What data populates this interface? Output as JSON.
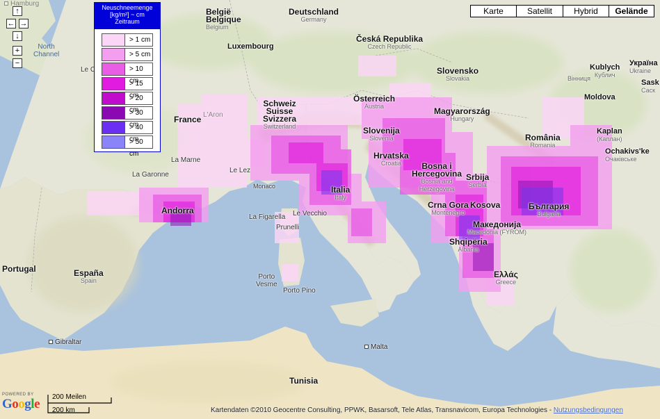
{
  "map_types": [
    {
      "label": "Karte",
      "active": false
    },
    {
      "label": "Satellit",
      "active": false
    },
    {
      "label": "Hybrid",
      "active": false
    },
    {
      "label": "Gelände",
      "active": true
    }
  ],
  "legend": {
    "title_line1": "Neuschneemenge",
    "title_line2": "[kg/m²] ~ cm",
    "title_line3": "Zeitraum",
    "rows": [
      {
        "label": "> 1 cm",
        "color": "#fbd6f6"
      },
      {
        "label": "> 5 cm",
        "color": "#f49ef0"
      },
      {
        "label": "> 10 cm",
        "color": "#ea5ee6"
      },
      {
        "label": "> 15 cm",
        "color": "#e21be0"
      },
      {
        "label": "> 20 cm",
        "color": "#c00ccc"
      },
      {
        "label": "> 30 cm",
        "color": "#8a09b2"
      },
      {
        "label": "> 40 cm",
        "color": "#6a2ff2"
      },
      {
        "label": "> 50 cm",
        "color": "#8b84f8"
      }
    ]
  },
  "nav": {
    "up": "↑",
    "left": "←",
    "right": "→",
    "down": "↓",
    "zoom_in": "+",
    "zoom_out": "−"
  },
  "labels": {
    "hamburg": "Hamburg",
    "north_channel_1": "North",
    "north_channel_2": "Channel",
    "le_c": "Le C",
    "belgie": "België",
    "belgique": "Belgique",
    "belgium": "Belgium",
    "luxembourg": "Luxembourg",
    "deutschland": "Deutschland",
    "germany": "Germany",
    "cesko": "Česká Republika",
    "czech": "Czech Republic",
    "slovensko": "Slovensko",
    "slovakia": "Slovakia",
    "kublych": "Kublych",
    "kublich": "Кублич",
    "ukraina": "Україна",
    "ukraine": "Ukraine",
    "sask": "Sask",
    "saskc": "Саск",
    "vinnytsia": "Вінниця",
    "moldova": "Moldova",
    "france": "France",
    "laron": "L'Aron",
    "schweiz": "Schweiz",
    "suisse": "Suisse",
    "svizzera": "Svizzera",
    "switzerland": "Switzerland",
    "osterreich": "Österreich",
    "austria": "Austria",
    "magyarorszag": "Magyarország",
    "hungary": "Hungary",
    "romania": "România",
    "romania_en": "Romania",
    "kaplan": "Kaplan",
    "kaplan_c": "(Каплан)",
    "ochakivske": "Ochakivs'ke",
    "ochakivske_c": "Очаківське",
    "la_marne": "La Marne",
    "la_garonne": "La Garonne",
    "le_lez": "Le Lez",
    "monaco": "Monaco",
    "slovenija": "Slovenija",
    "slovenia": "Slovenia",
    "hrvatska": "Hrvatska",
    "croatia": "Croatia",
    "bosna1": "Bosna i",
    "bosna2": "Hercegovina",
    "bosna_en": "Bosnia and",
    "bosna_en2": "Herzegovina",
    "srbija": "Srbija",
    "serbia": "Serbia",
    "italia": "Italia",
    "italy": "Italy",
    "andorra": "Andorra",
    "la_figarella": "La Figarella",
    "le_vecchio": "Le Vecchio",
    "prunelli": "Prunelli",
    "crna_gora": "Crna Gora",
    "montenegro": "Montenegro",
    "kosova": "Kosova",
    "bulgaria": "България",
    "bulgaria_en": "Bulgaria",
    "makedonija": "Македонија",
    "macedonia": "Macedonia (FYROM)",
    "shqiperia": "Shqipëria",
    "albania": "Albania",
    "ellas": "Ελλάς",
    "greece": "Greece",
    "espana": "España",
    "spain": "Spain",
    "portugal": "Portugal",
    "porto_vesme1": "Porto",
    "porto_vesme2": "Vesme",
    "porto_pino": "Porto Pino",
    "gibraltar": "Gibraltar",
    "malta": "Malta",
    "tunisia": "Tunisia"
  },
  "scale": {
    "miles": "200 Meilen",
    "km": "200 km"
  },
  "logo": {
    "powered_by": "POWERED BY",
    "google": "Google"
  },
  "copyright": {
    "text": "Kartendaten ©2010 Geocentre Consulting, PPWK, Basarsoft, Tele Atlas, Transnavicom, Europa Technologies - ",
    "link": "Nutzungsbedingungen"
  },
  "colors": {
    "sea": "#a9c2de",
    "land": "#e6e6d8",
    "land_green": "#cfe0b4",
    "sahara": "#efe5c4",
    "mountain": "#d8cdb3"
  }
}
